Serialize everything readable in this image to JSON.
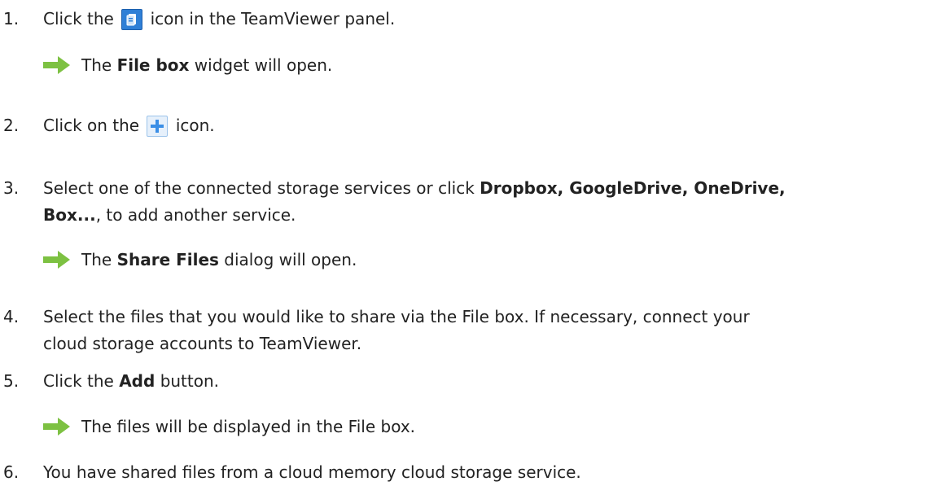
{
  "steps": [
    {
      "number": "1.",
      "before": "Click the",
      "icon": "file-box-icon",
      "after": "icon in the TeamViewer panel.",
      "result": {
        "before": "The",
        "bold": "File box",
        "after": "widget will open."
      }
    },
    {
      "number": "2.",
      "before": "Click on the",
      "icon": "plus-icon",
      "after": "icon."
    },
    {
      "number": "3.",
      "line1_before": "Select one of the connected storage services or click",
      "line1_bold": "Dropbox, GoogleDrive, OneDrive,",
      "line2_bold": "Box...",
      "line2_after": ", to add another service.",
      "result": {
        "before": "The",
        "bold": "Share Files",
        "after": "dialog will open."
      }
    },
    {
      "number": "4.",
      "line1": "Select the files that you would like to share via the File box. If necessary, connect your",
      "line2": "cloud storage accounts to TeamViewer."
    },
    {
      "number": "5.",
      "before": "Click the",
      "bold": "Add",
      "after": "button.",
      "result": {
        "text": "The files will be displayed in the File box."
      }
    },
    {
      "number": "6.",
      "text": "You have shared files from a cloud memory cloud storage service."
    }
  ],
  "colors": {
    "result_arrow": "#7dc142",
    "file_box_icon": "#2f7fd6",
    "plus_icon": "#3a8ee6",
    "text": "#222222"
  }
}
